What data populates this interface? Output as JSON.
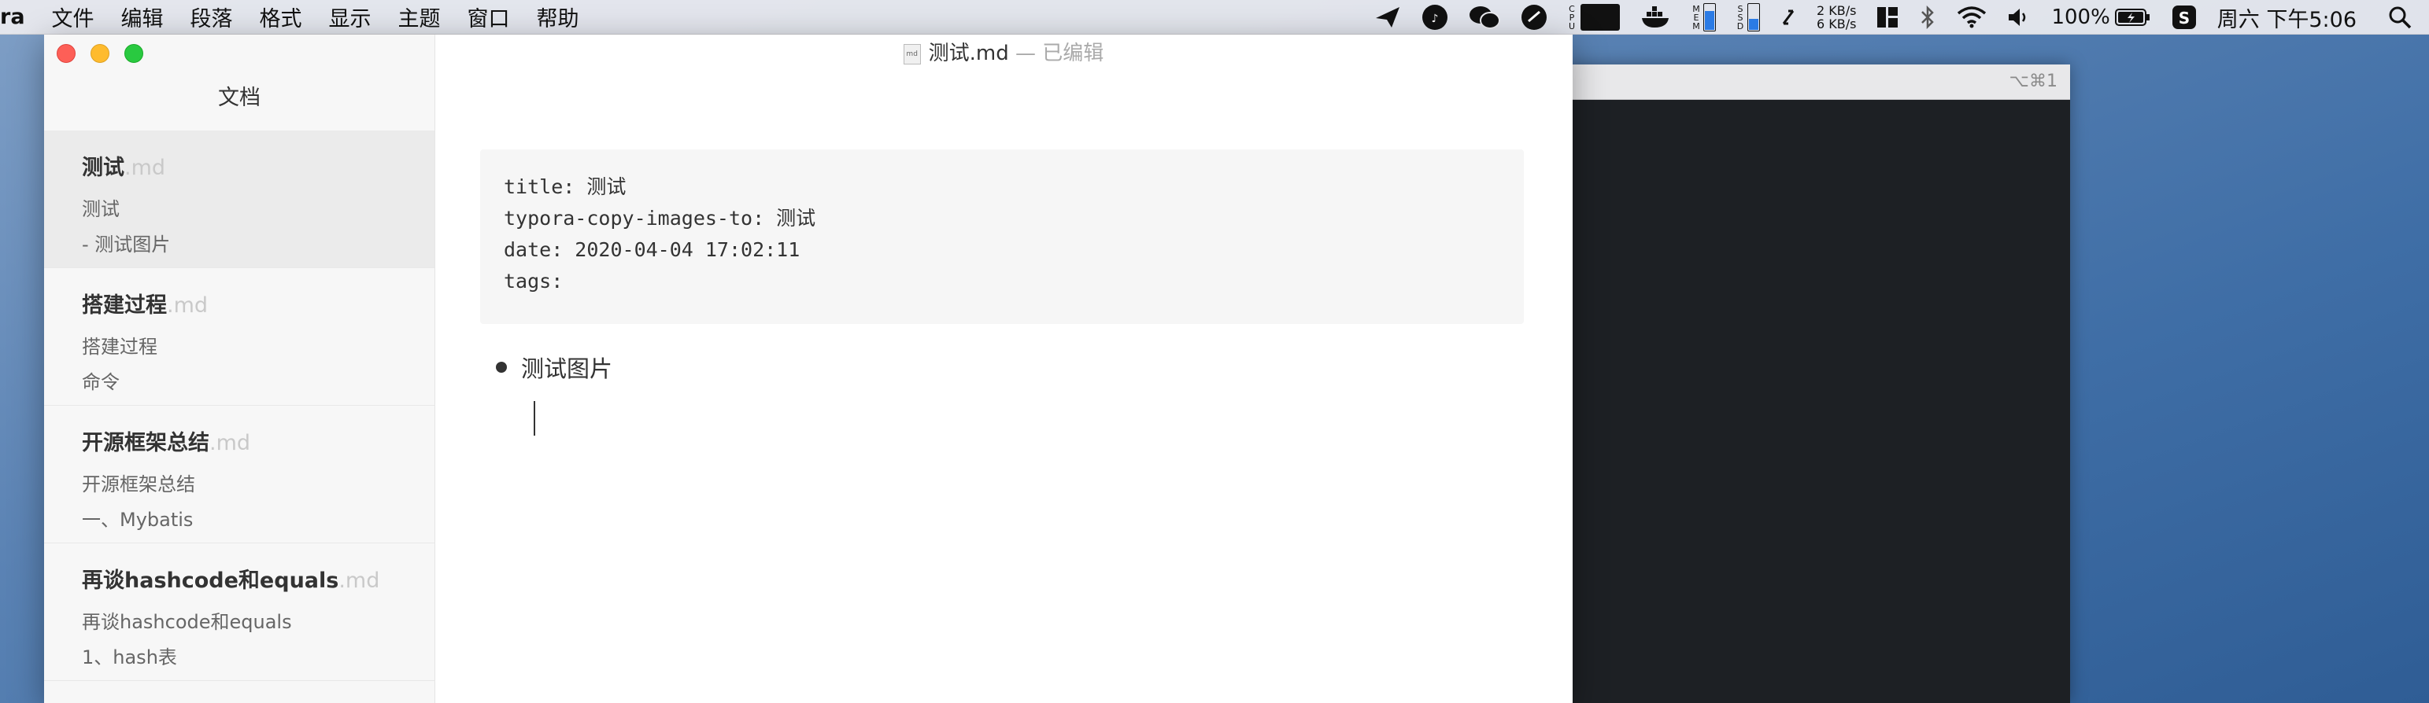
{
  "menubar": {
    "app_name": "ra",
    "items": [
      "文件",
      "编辑",
      "段落",
      "格式",
      "显示",
      "主题",
      "窗口",
      "帮助"
    ]
  },
  "status_bar": {
    "net_up": "2 KB/s",
    "net_down": "6 KB/s",
    "cpu_label": "CPU",
    "mem_label": "MEM",
    "ssd_label": "SSD",
    "battery": "100%",
    "clock": "周六 下午5:06",
    "icons": [
      "paper-plane-icon",
      "netease-icon",
      "wechat-icon",
      "app-icon",
      "cpu-graph-icon",
      "docker-icon",
      "mem-bar-icon",
      "ssd-bar-icon",
      "refresh-icon",
      "layout-icon",
      "bluetooth-icon",
      "wifi-icon",
      "volume-icon",
      "battery-icon",
      "s-app-icon",
      "search-icon"
    ]
  },
  "background_window": {
    "shortcut": "⌥⌘1"
  },
  "sidebar": {
    "title": "文档",
    "files": [
      {
        "name": "测试",
        "ext": ".md",
        "line1": "测试",
        "line2": "- 测试图片",
        "active": true
      },
      {
        "name": "搭建过程",
        "ext": ".md",
        "line1": "搭建过程",
        "line2": "命令",
        "active": false
      },
      {
        "name": "开源框架总结",
        "ext": ".md",
        "line1": "开源框架总结",
        "line2": "一、Mybatis",
        "active": false
      },
      {
        "name": "再谈hashcode和equals",
        "ext": ".md",
        "line1": "再谈hashcode和equals",
        "line2": "1、hash表",
        "active": false
      }
    ]
  },
  "titlebar": {
    "filename": "测试.md",
    "status": "— 已编辑",
    "doc_icon_text": "md"
  },
  "editor": {
    "front_matter": [
      "title: 测试",
      "typora-copy-images-to: 测试",
      "date: 2020-04-04 17:02:11",
      "tags:"
    ],
    "bullet_text": "测试图片"
  }
}
